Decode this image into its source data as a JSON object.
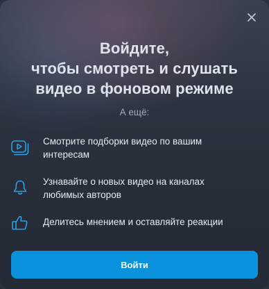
{
  "dialog": {
    "title_lines": [
      "Войдите,",
      "чтобы смотреть и слушать",
      "видео в фоновом режиме"
    ],
    "subtitle": "А ещё:",
    "features": [
      {
        "icon": "video-collection-icon",
        "text_lines": [
          "Смотрите подборки видео по вашим",
          "интересам"
        ]
      },
      {
        "icon": "bell-icon",
        "text_lines": [
          "Узнавайте о новых видео на каналах",
          "любимых авторов"
        ]
      },
      {
        "icon": "thumbs-up-icon",
        "text_lines": [
          "Делитесь мнением и оставляйте реакции"
        ]
      }
    ],
    "login_button": "Войти",
    "close_icon": "close-icon"
  },
  "colors": {
    "accent": "#0a93dc",
    "icon": "#2ea0e6",
    "text": "#e6eaf0",
    "muted": "#a5adb9"
  }
}
